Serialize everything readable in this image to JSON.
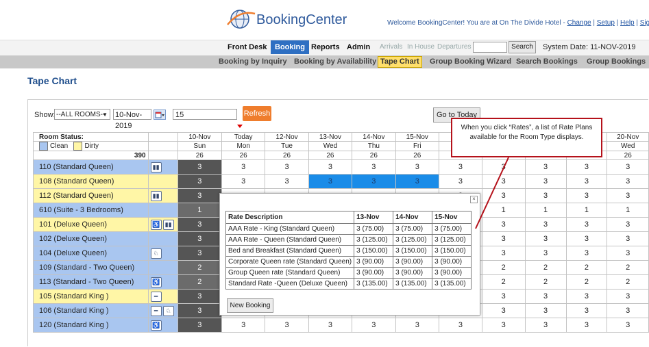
{
  "brand": {
    "name": "BookingCenter"
  },
  "welcome": {
    "text": "Welcome BookingCenter! You are at On The Divide Hotel - ",
    "change": "Change",
    "setup": "Setup",
    "help": "Help",
    "signoff": "Sign Off",
    "sep": " | "
  },
  "tabs": [
    "Front Desk",
    "Booking",
    "Reports",
    "Admin"
  ],
  "quick_links": [
    "Arrivals",
    "In House",
    "Departures"
  ],
  "search": {
    "value": "",
    "button": "Search"
  },
  "system_date": "System Date: 11-NOV-2019",
  "subnav": [
    "Booking by Inquiry",
    "Booking by Availability",
    "Tape Chart",
    "Group Booking Wizard",
    "Search Bookings",
    "Group Bookings"
  ],
  "page_title": "Tape Chart",
  "toolbar": {
    "show_label": "Show:",
    "room_filter": "--ALL ROOMS--",
    "date": "10-Nov-2019",
    "days": "15",
    "refresh": "Refresh",
    "goto_today": "Go to Today"
  },
  "grid": {
    "status_label": "Room Status:",
    "legend": {
      "clean": "Clean",
      "dirty": "Dirty"
    },
    "total": "390",
    "dates": [
      "10-Nov",
      "Today",
      "12-Nov",
      "13-Nov",
      "14-Nov",
      "15-Nov",
      "",
      "",
      "",
      "",
      "20-Nov"
    ],
    "days": [
      "Sun",
      "Mon",
      "Tue",
      "Wed",
      "Thu",
      "Fri",
      "",
      "",
      "",
      "",
      "Wed"
    ],
    "totals": [
      "26",
      "26",
      "26",
      "26",
      "26",
      "26",
      "",
      "",
      "",
      "",
      "26"
    ],
    "rooms": [
      {
        "name": "110 (Standard Queen)",
        "status": "clean",
        "features": [
          "bed"
        ],
        "values": [
          "3",
          "3",
          "3",
          "3",
          "3",
          "3",
          "3",
          "3",
          "3",
          "3",
          "3"
        ]
      },
      {
        "name": "108 (Standard Queen)",
        "status": "dirty",
        "features": [],
        "values": [
          "3",
          "3",
          "3",
          "3",
          "3",
          "3",
          "3",
          "3",
          "3",
          "3",
          "3"
        ]
      },
      {
        "name": "112 (Standard Queen)",
        "status": "dirty",
        "features": [
          "bed"
        ],
        "values": [
          "3",
          "",
          "",
          "",
          "",
          "",
          "3",
          "3",
          "3",
          "3",
          "3"
        ]
      },
      {
        "name": "610 (Suite - 3 Bedrooms)",
        "status": "clean",
        "features": [],
        "values": [
          "1",
          "",
          "",
          "",
          "",
          "",
          "1",
          "1",
          "1",
          "1",
          "1"
        ]
      },
      {
        "name": "101 (Deluxe Queen)",
        "status": "dirty",
        "features": [
          "accessible",
          "bed"
        ],
        "values": [
          "3",
          "",
          "",
          "",
          "",
          "",
          "3",
          "3",
          "3",
          "3",
          "3"
        ]
      },
      {
        "name": "102 (Deluxe Queen)",
        "status": "clean",
        "features": [],
        "values": [
          "3",
          "",
          "",
          "",
          "",
          "",
          "3",
          "3",
          "3",
          "3",
          "3"
        ]
      },
      {
        "name": "104 (Deluxe Queen)",
        "status": "clean",
        "features": [
          "pet"
        ],
        "values": [
          "3",
          "",
          "",
          "",
          "",
          "",
          "3",
          "3",
          "3",
          "3",
          "3"
        ]
      },
      {
        "name": "109 (Standard - Two Queen)",
        "status": "clean",
        "features": [],
        "values": [
          "2",
          "",
          "",
          "",
          "",
          "",
          "2",
          "2",
          "2",
          "2",
          "2"
        ]
      },
      {
        "name": "113 (Standard - Two Queen)",
        "status": "clean",
        "features": [
          "accessible"
        ],
        "values": [
          "2",
          "",
          "",
          "",
          "",
          "",
          "2",
          "2",
          "2",
          "2",
          "2"
        ]
      },
      {
        "name": "105 (Standard King )",
        "status": "dirty",
        "features": [
          "smoking"
        ],
        "values": [
          "3",
          "",
          "",
          "",
          "",
          "",
          "3",
          "3",
          "3",
          "3",
          "3"
        ]
      },
      {
        "name": "106 (Standard King )",
        "status": "clean",
        "features": [
          "smoking",
          "pet"
        ],
        "values": [
          "3",
          "3",
          "3",
          "3",
          "3",
          "3",
          "3",
          "3",
          "3",
          "3",
          "3"
        ]
      },
      {
        "name": "120 (Standard King )",
        "status": "clean",
        "features": [
          "accessible"
        ],
        "values": [
          "3",
          "3",
          "3",
          "3",
          "3",
          "3",
          "3",
          "3",
          "3",
          "3",
          "3"
        ]
      }
    ]
  },
  "popup": {
    "close": "×",
    "headers": [
      "Rate Description",
      "13-Nov",
      "14-Nov",
      "15-Nov"
    ],
    "rows": [
      [
        "AAA Rate - King (Standard Queen)",
        "3 (75.00)",
        "3 (75.00)",
        "3 (75.00)"
      ],
      [
        "AAA Rate - Queen (Standard Queen)",
        "3 (125.00)",
        "3 (125.00)",
        "3 (125.00)"
      ],
      [
        "Bed and Breakfast (Standard Queen)",
        "3 (150.00)",
        "3 (150.00)",
        "3 (150.00)"
      ],
      [
        "Corporate Queen rate (Standard Queen)",
        "3 (90.00)",
        "3 (90.00)",
        "3 (90.00)"
      ],
      [
        "Group Queen rate (Standard Queen)",
        "3 (90.00)",
        "3 (90.00)",
        "3 (90.00)"
      ],
      [
        "Standard Rate -Queen (Deluxe Queen)",
        "3 (135.00)",
        "3 (135.00)",
        "3 (135.00)"
      ]
    ],
    "new_booking": "New Booking"
  },
  "callout": {
    "text": "When you  click “Rates”, a list of Rate Plans available for the Room Type displays."
  },
  "colors": {
    "accent": "#2e6fc2",
    "refresh": "#ef7d2d",
    "clean": "#a9c6f0",
    "dirty": "#fff6a6",
    "callout": "#b5121b"
  }
}
